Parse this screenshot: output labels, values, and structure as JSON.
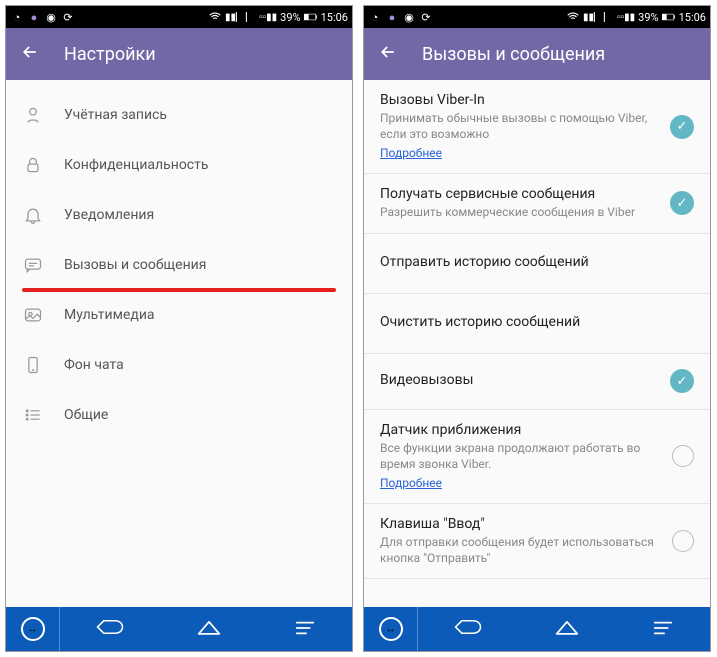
{
  "status": {
    "battery": "39%",
    "time": "15:06"
  },
  "left": {
    "header_title": "Настройки",
    "items": [
      {
        "label": "Учётная запись"
      },
      {
        "label": "Конфиденциальность"
      },
      {
        "label": "Уведомления"
      },
      {
        "label": "Вызовы и сообщения"
      },
      {
        "label": "Мультимедиа"
      },
      {
        "label": "Фон чата"
      },
      {
        "label": "Общие"
      }
    ]
  },
  "right": {
    "header_title": "Вызовы и сообщения",
    "rows": [
      {
        "title": "Вызовы Viber-In",
        "sub": "Принимать обычные вызовы с помощью Viber, если это возможно",
        "link": "Подробнее",
        "checked": true
      },
      {
        "title": "Получать сервисные сообщения",
        "sub": "Разрешить коммерческие сообщения в Viber",
        "checked": true
      },
      {
        "title": "Отправить историю сообщений"
      },
      {
        "title": "Очистить историю сообщений"
      },
      {
        "title": "Видеовызовы",
        "checked": true
      },
      {
        "title": "Датчик приближения",
        "sub": "Все функции экрана продолжают работать во время звонка Viber.",
        "link": "Подробнее",
        "checked": false
      },
      {
        "title": "Клавиша \"Ввод\"",
        "sub": "Для отправки сообщения будет использоваться кнопка \"Отправить\"",
        "checked": false
      }
    ]
  }
}
